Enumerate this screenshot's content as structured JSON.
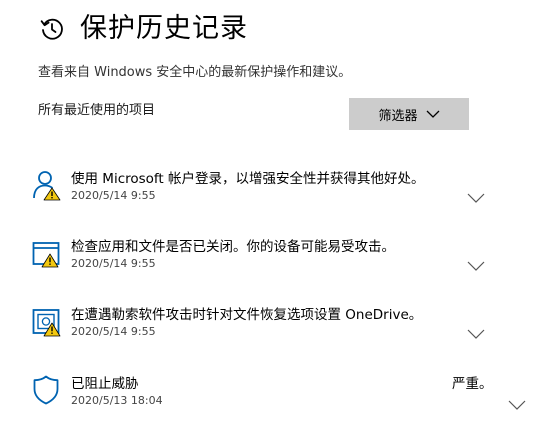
{
  "header": {
    "title": "保护历史记录",
    "subtitle": "查看来自 Windows 安全中心的最新保护操作和建议。"
  },
  "section": {
    "label": "所有最近使用的项目",
    "filter_label": "筛选器"
  },
  "items": [
    {
      "title": "使用 Microsoft 帐户登录，以增强安全性并获得其他好处。",
      "date": "2020/5/14 9:55",
      "icon": "account-warning-icon"
    },
    {
      "title": "检查应用和文件是否已关闭。你的设备可能易受攻击。",
      "date": "2020/5/14 9:55",
      "icon": "app-browser-warning-icon"
    },
    {
      "title": "在遭遇勒索软件攻击时针对文件恢复选项设置 OneDrive。",
      "date": "2020/5/14 9:55",
      "icon": "ransomware-warning-icon"
    },
    {
      "title": "已阻止威胁",
      "date": "2020/5/13 18:04",
      "severity": "严重。",
      "icon": "shield-icon"
    }
  ],
  "colors": {
    "accent": "#0063b1",
    "warning": "#f2c811",
    "filter_bg": "#cccccc"
  }
}
